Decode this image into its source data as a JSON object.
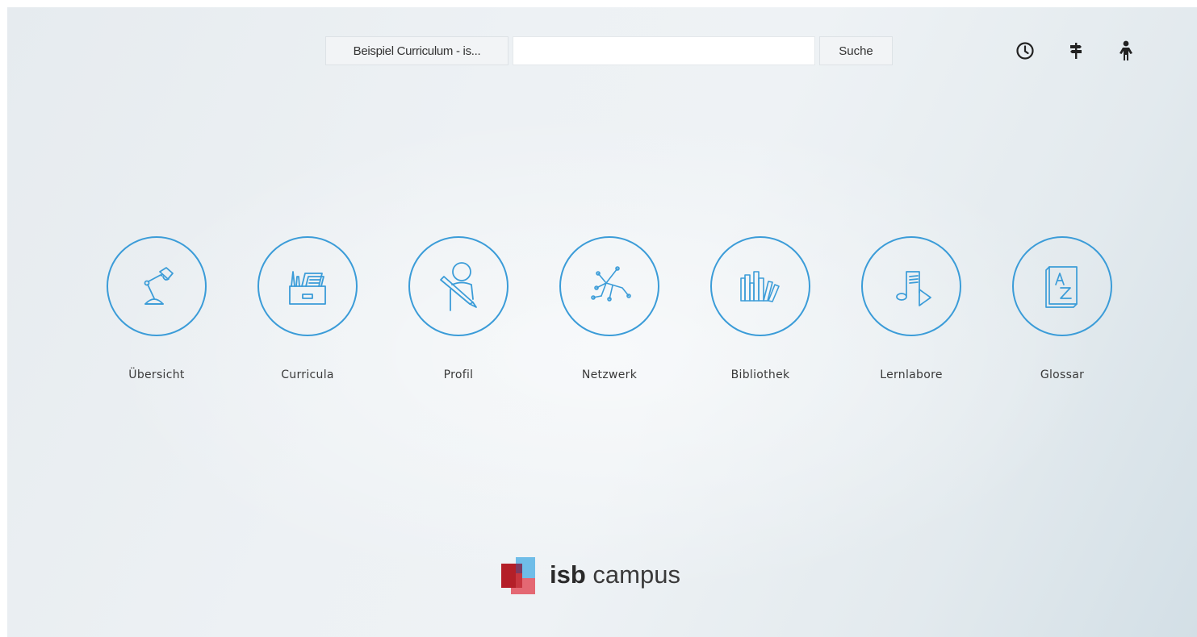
{
  "header": {
    "curriculum_select": "Beispiel Curriculum - is...",
    "search_placeholder": "",
    "search_button": "Suche",
    "icons": [
      "clock-icon",
      "signpost-icon",
      "person-icon"
    ]
  },
  "tiles": [
    {
      "label": "Übersicht",
      "icon": "desk-lamp-icon"
    },
    {
      "label": "Curricula",
      "icon": "file-drawer-icon"
    },
    {
      "label": "Profil",
      "icon": "profile-pen-icon"
    },
    {
      "label": "Netzwerk",
      "icon": "network-icon"
    },
    {
      "label": "Bibliothek",
      "icon": "books-icon"
    },
    {
      "label": "Lernlabore",
      "icon": "music-play-icon"
    },
    {
      "label": "Glossar",
      "icon": "glossary-az-icon"
    }
  ],
  "logo": {
    "bold": "isb",
    "rest": " campus"
  },
  "colors": {
    "accent": "#3b9cd8",
    "logo_red": "#c0252c",
    "logo_blue": "#5ab0e2"
  }
}
